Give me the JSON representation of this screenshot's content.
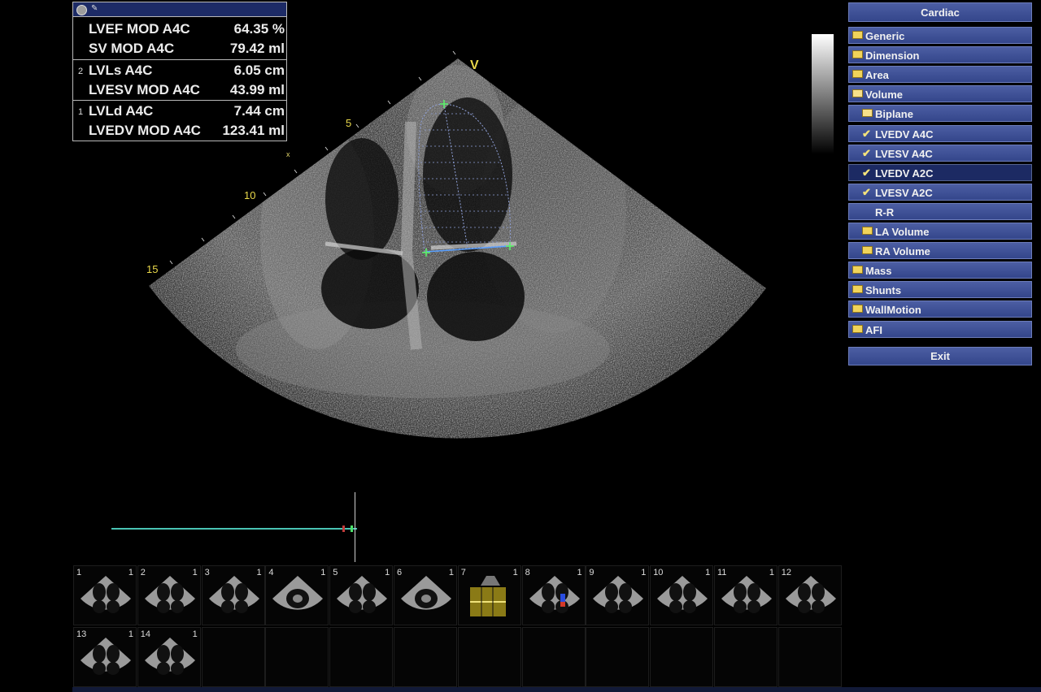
{
  "measurements": {
    "rows": [
      {
        "index": "",
        "label": "LVEF MOD A4C",
        "value": "64.35 %"
      },
      {
        "index": "",
        "label": "SV MOD A4C",
        "value": "79.42 ml"
      },
      {
        "index": "2",
        "label": "LVLs A4C",
        "value": "6.05 cm"
      },
      {
        "index": "",
        "label": "LVESV MOD A4C",
        "value": "43.99 ml"
      },
      {
        "index": "1",
        "label": "LVLd A4C",
        "value": "7.44 cm"
      },
      {
        "index": "",
        "label": "LVEDV MOD A4C",
        "value": "123.41 ml"
      }
    ]
  },
  "image": {
    "depth_marks": [
      "5",
      "10",
      "15"
    ],
    "orientation_marker": "V"
  },
  "menu": {
    "header": "Cardiac",
    "items": [
      {
        "label": "Generic",
        "icon": "folder-closed-icon",
        "selected": false
      },
      {
        "label": "Dimension",
        "icon": "folder-closed-icon",
        "selected": false
      },
      {
        "label": "Area",
        "icon": "folder-closed-icon",
        "selected": false
      },
      {
        "label": "Volume",
        "icon": "folder-open-icon",
        "selected": false
      },
      {
        "label": "Biplane",
        "icon": "folder-open-icon",
        "selected": false
      },
      {
        "label": "LVEDV A4C",
        "icon": "check-icon",
        "selected": false
      },
      {
        "label": "LVESV A4C",
        "icon": "check-icon",
        "selected": false
      },
      {
        "label": "LVEDV A2C",
        "icon": "check-icon",
        "selected": true
      },
      {
        "label": "LVESV A2C",
        "icon": "check-icon",
        "selected": false
      },
      {
        "label": "R-R",
        "icon": "",
        "selected": false
      },
      {
        "label": "LA Volume",
        "icon": "folder-closed-icon",
        "selected": false
      },
      {
        "label": "RA Volume",
        "icon": "folder-closed-icon",
        "selected": false
      },
      {
        "label": "Mass",
        "icon": "folder-closed-icon",
        "selected": false
      },
      {
        "label": "Shunts",
        "icon": "folder-closed-icon",
        "selected": false
      },
      {
        "label": "WallMotion",
        "icon": "folder-closed-icon",
        "selected": false
      },
      {
        "label": "AFI",
        "icon": "folder-closed-icon",
        "selected": false
      }
    ],
    "exit": "Exit"
  },
  "thumbnails": [
    {
      "num": "1",
      "count": "1",
      "kind": "a4c"
    },
    {
      "num": "2",
      "count": "1",
      "kind": "a4c"
    },
    {
      "num": "3",
      "count": "1",
      "kind": "a4c"
    },
    {
      "num": "4",
      "count": "1",
      "kind": "sax"
    },
    {
      "num": "5",
      "count": "1",
      "kind": "a4c"
    },
    {
      "num": "6",
      "count": "1",
      "kind": "sax"
    },
    {
      "num": "7",
      "count": "1",
      "kind": "doppler"
    },
    {
      "num": "8",
      "count": "1",
      "kind": "color"
    },
    {
      "num": "9",
      "count": "1",
      "kind": "a4c"
    },
    {
      "num": "10",
      "count": "1",
      "kind": "a4c"
    },
    {
      "num": "11",
      "count": "1",
      "kind": "a4c"
    },
    {
      "num": "12",
      "count": "",
      "kind": "a4c"
    },
    {
      "num": "13",
      "count": "1",
      "kind": "a4c"
    },
    {
      "num": "14",
      "count": "1",
      "kind": "a4c"
    },
    {
      "num": "",
      "count": "",
      "kind": "empty"
    },
    {
      "num": "",
      "count": "",
      "kind": "empty"
    },
    {
      "num": "",
      "count": "",
      "kind": "empty"
    },
    {
      "num": "",
      "count": "",
      "kind": "empty"
    },
    {
      "num": "",
      "count": "",
      "kind": "empty"
    },
    {
      "num": "",
      "count": "",
      "kind": "empty"
    },
    {
      "num": "",
      "count": "",
      "kind": "empty"
    },
    {
      "num": "",
      "count": "",
      "kind": "empty"
    },
    {
      "num": "",
      "count": "",
      "kind": "empty"
    },
    {
      "num": "",
      "count": "",
      "kind": "empty"
    }
  ],
  "colors": {
    "menu_bg": "#3c4e93",
    "menu_selected": "#1c2a63",
    "timeline": "#49c3b4",
    "annotation": "#e9d84a",
    "caliper": "#5cf06a"
  }
}
